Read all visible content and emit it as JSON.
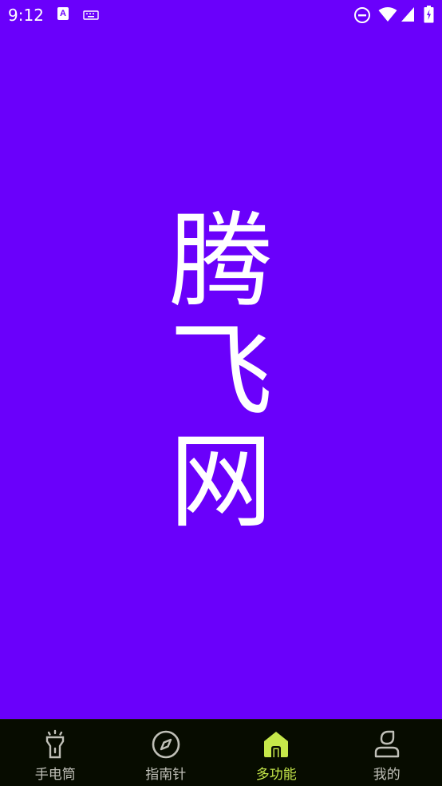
{
  "status_bar": {
    "time": "9:12",
    "icons": [
      "text-a-icon",
      "keyboard-icon",
      "do-not-disturb-icon",
      "wifi-icon",
      "signal-icon",
      "battery-icon"
    ]
  },
  "hero": {
    "chars": [
      "腾",
      "飞",
      "网"
    ]
  },
  "bottom_nav": {
    "items": [
      {
        "label": "手电筒",
        "icon": "flashlight-icon"
      },
      {
        "label": "指南针",
        "icon": "compass-icon"
      },
      {
        "label": "多功能",
        "icon": "home-icon",
        "active": true
      },
      {
        "label": "我的",
        "icon": "profile-icon"
      }
    ],
    "active_color": "#c6e84a",
    "inactive_color": "#c0c0b8"
  },
  "colors": {
    "background": "#6a00fb",
    "nav_background": "#070c00"
  }
}
